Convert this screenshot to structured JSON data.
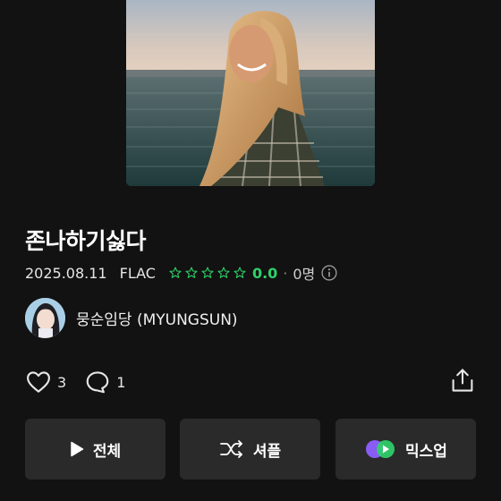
{
  "album": {
    "title": "존나하기싫다",
    "date": "2025.08.11",
    "format": "FLAC",
    "stars_total": 5,
    "rating": "0.0",
    "dot": "·",
    "rating_count": "0명"
  },
  "artist": {
    "name": "뭉순임당 (MYUNGSUN)"
  },
  "social": {
    "likes": "3",
    "comments": "1"
  },
  "buttons": {
    "play_all": "전체",
    "shuffle": "셔플",
    "mixup": "믹스업"
  },
  "colors": {
    "background": "#121212",
    "accent_green": "#2fd16a",
    "button_bg": "#2a2a2a"
  },
  "icons": [
    "heart-icon",
    "comment-icon",
    "share-icon",
    "play-icon",
    "shuffle-icon",
    "mixup-icon",
    "star-icon",
    "info-icon"
  ]
}
